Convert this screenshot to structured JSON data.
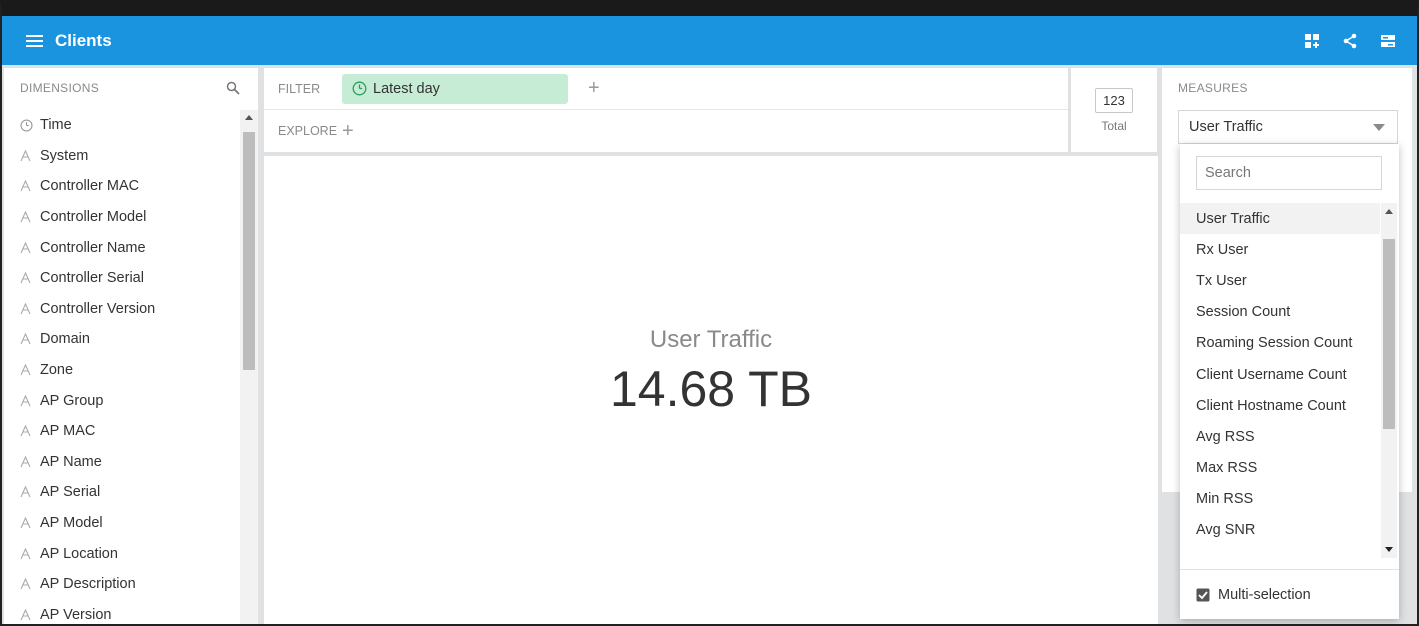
{
  "app": {
    "title": "Clients"
  },
  "top_actions": [
    {
      "name": "add-dashboard-icon"
    },
    {
      "name": "share-icon"
    },
    {
      "name": "settings-panel-icon"
    }
  ],
  "dimensions": {
    "header": "DIMENSIONS",
    "items": [
      {
        "label": "Time",
        "icon": "clock-icon"
      },
      {
        "label": "System",
        "icon": "string-type-icon"
      },
      {
        "label": "Controller MAC",
        "icon": "string-type-icon"
      },
      {
        "label": "Controller Model",
        "icon": "string-type-icon"
      },
      {
        "label": "Controller Name",
        "icon": "string-type-icon"
      },
      {
        "label": "Controller Serial",
        "icon": "string-type-icon"
      },
      {
        "label": "Controller Version",
        "icon": "string-type-icon"
      },
      {
        "label": "Domain",
        "icon": "string-type-icon"
      },
      {
        "label": "Zone",
        "icon": "string-type-icon"
      },
      {
        "label": "AP Group",
        "icon": "string-type-icon"
      },
      {
        "label": "AP MAC",
        "icon": "string-type-icon"
      },
      {
        "label": "AP Name",
        "icon": "string-type-icon"
      },
      {
        "label": "AP Serial",
        "icon": "string-type-icon"
      },
      {
        "label": "AP Model",
        "icon": "string-type-icon"
      },
      {
        "label": "AP Location",
        "icon": "string-type-icon"
      },
      {
        "label": "AP Description",
        "icon": "string-type-icon"
      },
      {
        "label": "AP Version",
        "icon": "string-type-icon"
      }
    ]
  },
  "filter": {
    "label": "FILTER",
    "pill": "Latest day",
    "add": "+"
  },
  "explore": {
    "label": "EXPLORE",
    "add": "+"
  },
  "total": {
    "value": "123",
    "label": "Total"
  },
  "main": {
    "measure_label": "User Traffic",
    "measure_value": "14.68 TB"
  },
  "measures": {
    "header": "MEASURES",
    "selected": "User Traffic",
    "search_placeholder": "Search",
    "options": [
      "User Traffic",
      "Rx User",
      "Tx User",
      "Session Count",
      "Roaming Session Count",
      "Client Username Count",
      "Client Hostname Count",
      "Avg RSS",
      "Max RSS",
      "Min RSS",
      "Avg SNR"
    ],
    "multi_selection": "Multi-selection"
  },
  "colors": {
    "topbar": "#1a94df",
    "pill": "#c7ecd5"
  }
}
